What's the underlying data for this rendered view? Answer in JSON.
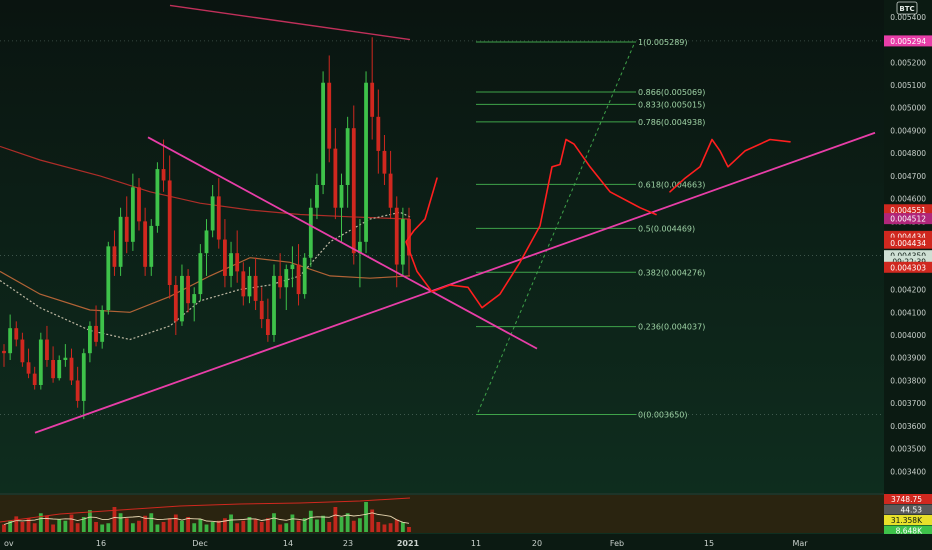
{
  "symbol_badge": "BTC",
  "colors": {
    "bg_top": "#0a1410",
    "bg_bottom": "#0f3020",
    "up": "#3ec24a",
    "down": "#d0281f",
    "fib": "#3fa34a",
    "trend": "#e83ea8",
    "drawn": "#ff1f1f",
    "ma_slow": "#c0302a",
    "ma_mid": "#c46a3a",
    "ma_fast": "#cfc6b0",
    "axis_text": "#c9d1cc"
  },
  "price_axis": {
    "ticks": [
      "0.005400",
      "0.005300",
      "0.005200",
      "0.005100",
      "0.005000",
      "0.004900",
      "0.004800",
      "0.004700",
      "0.004600",
      "0.004500",
      "0.004400",
      "0.004300",
      "0.004200",
      "0.004100",
      "0.004000",
      "0.003900",
      "0.003800",
      "0.003700",
      "0.003600",
      "0.003500",
      "0.003400"
    ],
    "badges": [
      {
        "text": "0.005294",
        "value": 0.005294,
        "bg": "#e83ea8",
        "fg": "#ffffff"
      },
      {
        "text": "0.004551",
        "value": 0.004551,
        "bg": "#d0281f",
        "fg": "#ffffff"
      },
      {
        "text": "0.004512",
        "value": 0.004512,
        "bg": "#b0267a",
        "fg": "#ffffff"
      },
      {
        "text": "0.004434",
        "value": 0.004434,
        "bg": "#d0281f",
        "fg": "#ffffff"
      },
      {
        "text": "0.004434",
        "value": 0.004404,
        "bg": "#d0281f",
        "fg": "#ffffff"
      },
      {
        "text": "0.004350",
        "value": 0.004349,
        "bg": "#cfe0d4",
        "fg": "#0b1a12"
      },
      {
        "text": "09:22:39",
        "value": 0.004324,
        "bg": "#cfe0d4",
        "fg": "#0b1a12"
      },
      {
        "text": "0.004303",
        "value": 0.004298,
        "bg": "#d0281f",
        "fg": "#ffffff"
      }
    ]
  },
  "volume_axis": {
    "badges": [
      {
        "text": "3748.75",
        "bg": "#d0281f",
        "fg": "#ffffff"
      },
      {
        "text": "44.53",
        "bg": "#5a5a5a",
        "fg": "#ffffff"
      },
      {
        "text": "31.358K",
        "bg": "#e8e02a",
        "fg": "#0b1a12"
      },
      {
        "text": "8.648K",
        "bg": "#3ec24a",
        "fg": "#ffffff"
      }
    ]
  },
  "time_axis": [
    "ov",
    "16",
    "Dec",
    "14",
    "23",
    "2021",
    "11",
    "20",
    "Feb",
    "15",
    "Mar"
  ],
  "chart_data": {
    "type": "candlestick",
    "pair": "BTC",
    "y_range": [
      0.00334,
      0.00543
    ],
    "categories": [
      "Nov",
      "16",
      "Dec",
      "14",
      "23",
      "2021",
      "11",
      "20",
      "Feb",
      "15",
      "Mar"
    ],
    "fib_levels": [
      {
        "label": "1(0.005289)",
        "value": 0.005289
      },
      {
        "label": "0.866(0.005069)",
        "value": 0.005069
      },
      {
        "label": "0.833(0.005015)",
        "value": 0.005015
      },
      {
        "label": "0.786(0.004938)",
        "value": 0.004938
      },
      {
        "label": "0.618(0.004663)",
        "value": 0.004663
      },
      {
        "label": "0.5(0.004469)",
        "value": 0.004469
      },
      {
        "label": "0.382(0.004276)",
        "value": 0.004276
      },
      {
        "label": "0.236(0.004037)",
        "value": 0.004037
      },
      {
        "label": "0(0.003650)",
        "value": 0.00365
      }
    ],
    "guide_levels": [
      0.005294,
      0.00435,
      0.00365
    ],
    "trendlines": [
      {
        "name": "support",
        "from": [
          35,
          0.00357
        ],
        "to": [
          875,
          0.00489
        ]
      },
      {
        "name": "resistance",
        "from": [
          148,
          0.00487
        ],
        "to": [
          537,
          0.00394
        ]
      },
      {
        "name": "upper",
        "from": [
          170,
          0.00545
        ],
        "to": [
          410,
          0.0053
        ]
      }
    ],
    "fib_diagonal": {
      "from": [
        478,
        0.00366
      ],
      "to": [
        634,
        0.00528
      ]
    },
    "candles": [
      {
        "o": 0.00393,
        "h": 0.00396,
        "l": 0.00386,
        "c": 0.00392
      },
      {
        "o": 0.00392,
        "h": 0.00409,
        "l": 0.00389,
        "c": 0.00403
      },
      {
        "o": 0.00403,
        "h": 0.00406,
        "l": 0.00395,
        "c": 0.00398
      },
      {
        "o": 0.00398,
        "h": 0.00401,
        "l": 0.00386,
        "c": 0.00388
      },
      {
        "o": 0.00388,
        "h": 0.00394,
        "l": 0.00381,
        "c": 0.00383
      },
      {
        "o": 0.00383,
        "h": 0.00386,
        "l": 0.00376,
        "c": 0.00378
      },
      {
        "o": 0.00378,
        "h": 0.00401,
        "l": 0.00376,
        "c": 0.00398
      },
      {
        "o": 0.00398,
        "h": 0.00404,
        "l": 0.00386,
        "c": 0.00389
      },
      {
        "o": 0.00389,
        "h": 0.00395,
        "l": 0.00379,
        "c": 0.00381
      },
      {
        "o": 0.00381,
        "h": 0.00391,
        "l": 0.0038,
        "c": 0.00389
      },
      {
        "o": 0.00389,
        "h": 0.00396,
        "l": 0.00386,
        "c": 0.0039
      },
      {
        "o": 0.0039,
        "h": 0.00394,
        "l": 0.00378,
        "c": 0.0038
      },
      {
        "o": 0.0038,
        "h": 0.00386,
        "l": 0.00368,
        "c": 0.00371
      },
      {
        "o": 0.00371,
        "h": 0.00394,
        "l": 0.00363,
        "c": 0.00392
      },
      {
        "o": 0.00392,
        "h": 0.00406,
        "l": 0.00388,
        "c": 0.00404
      },
      {
        "o": 0.00404,
        "h": 0.00413,
        "l": 0.00395,
        "c": 0.00397
      },
      {
        "o": 0.00397,
        "h": 0.00413,
        "l": 0.00394,
        "c": 0.00411
      },
      {
        "o": 0.00411,
        "h": 0.00441,
        "l": 0.00409,
        "c": 0.00439
      },
      {
        "o": 0.00439,
        "h": 0.00446,
        "l": 0.00426,
        "c": 0.0043
      },
      {
        "o": 0.0043,
        "h": 0.00456,
        "l": 0.00426,
        "c": 0.00452
      },
      {
        "o": 0.00452,
        "h": 0.00461,
        "l": 0.00436,
        "c": 0.00441
      },
      {
        "o": 0.00441,
        "h": 0.00471,
        "l": 0.00437,
        "c": 0.00465
      },
      {
        "o": 0.00465,
        "h": 0.00469,
        "l": 0.00446,
        "c": 0.0045
      },
      {
        "o": 0.0045,
        "h": 0.00456,
        "l": 0.00426,
        "c": 0.0043
      },
      {
        "o": 0.0043,
        "h": 0.00451,
        "l": 0.00426,
        "c": 0.00448
      },
      {
        "o": 0.00448,
        "h": 0.00476,
        "l": 0.00445,
        "c": 0.00473
      },
      {
        "o": 0.00473,
        "h": 0.00486,
        "l": 0.00463,
        "c": 0.00468
      },
      {
        "o": 0.00468,
        "h": 0.00479,
        "l": 0.00416,
        "c": 0.00422
      },
      {
        "o": 0.00422,
        "h": 0.00426,
        "l": 0.004,
        "c": 0.00406
      },
      {
        "o": 0.00406,
        "h": 0.00431,
        "l": 0.00404,
        "c": 0.00426
      },
      {
        "o": 0.00426,
        "h": 0.00429,
        "l": 0.0041,
        "c": 0.00414
      },
      {
        "o": 0.00414,
        "h": 0.00421,
        "l": 0.00406,
        "c": 0.00418
      },
      {
        "o": 0.00418,
        "h": 0.0044,
        "l": 0.00415,
        "c": 0.00436
      },
      {
        "o": 0.00436,
        "h": 0.00451,
        "l": 0.00426,
        "c": 0.00446
      },
      {
        "o": 0.00446,
        "h": 0.00466,
        "l": 0.00443,
        "c": 0.00461
      },
      {
        "o": 0.00461,
        "h": 0.00469,
        "l": 0.00438,
        "c": 0.00442
      },
      {
        "o": 0.00442,
        "h": 0.00451,
        "l": 0.00421,
        "c": 0.00426
      },
      {
        "o": 0.00426,
        "h": 0.00441,
        "l": 0.00421,
        "c": 0.00436
      },
      {
        "o": 0.00436,
        "h": 0.00446,
        "l": 0.00423,
        "c": 0.00428
      },
      {
        "o": 0.00428,
        "h": 0.00432,
        "l": 0.00413,
        "c": 0.00417
      },
      {
        "o": 0.00417,
        "h": 0.0043,
        "l": 0.00414,
        "c": 0.00426
      },
      {
        "o": 0.00426,
        "h": 0.00434,
        "l": 0.00411,
        "c": 0.00415
      },
      {
        "o": 0.00415,
        "h": 0.00421,
        "l": 0.00403,
        "c": 0.00407
      },
      {
        "o": 0.00407,
        "h": 0.00416,
        "l": 0.00397,
        "c": 0.004
      },
      {
        "o": 0.004,
        "h": 0.00431,
        "l": 0.00397,
        "c": 0.00426
      },
      {
        "o": 0.00426,
        "h": 0.00436,
        "l": 0.00416,
        "c": 0.00421
      },
      {
        "o": 0.00421,
        "h": 0.00431,
        "l": 0.00411,
        "c": 0.00429
      },
      {
        "o": 0.00429,
        "h": 0.00439,
        "l": 0.00421,
        "c": 0.00431
      },
      {
        "o": 0.00431,
        "h": 0.0044,
        "l": 0.00413,
        "c": 0.00418
      },
      {
        "o": 0.00418,
        "h": 0.00436,
        "l": 0.00416,
        "c": 0.00434
      },
      {
        "o": 0.00434,
        "h": 0.0046,
        "l": 0.0043,
        "c": 0.00456
      },
      {
        "o": 0.00456,
        "h": 0.00471,
        "l": 0.00451,
        "c": 0.00466
      },
      {
        "o": 0.00466,
        "h": 0.00516,
        "l": 0.00462,
        "c": 0.00511
      },
      {
        "o": 0.00511,
        "h": 0.00523,
        "l": 0.00476,
        "c": 0.00482
      },
      {
        "o": 0.00482,
        "h": 0.00491,
        "l": 0.00451,
        "c": 0.00456
      },
      {
        "o": 0.00456,
        "h": 0.00471,
        "l": 0.00441,
        "c": 0.00466
      },
      {
        "o": 0.00466,
        "h": 0.00496,
        "l": 0.00456,
        "c": 0.00491
      },
      {
        "o": 0.00491,
        "h": 0.00501,
        "l": 0.00431,
        "c": 0.00436
      },
      {
        "o": 0.00436,
        "h": 0.00451,
        "l": 0.00421,
        "c": 0.00441
      },
      {
        "o": 0.00441,
        "h": 0.00516,
        "l": 0.00436,
        "c": 0.00511
      },
      {
        "o": 0.00511,
        "h": 0.00531,
        "l": 0.00486,
        "c": 0.00496
      },
      {
        "o": 0.00496,
        "h": 0.00508,
        "l": 0.00471,
        "c": 0.00481
      },
      {
        "o": 0.00481,
        "h": 0.00488,
        "l": 0.00466,
        "c": 0.00471
      },
      {
        "o": 0.00471,
        "h": 0.00481,
        "l": 0.00451,
        "c": 0.00456
      },
      {
        "o": 0.00456,
        "h": 0.00461,
        "l": 0.00421,
        "c": 0.00431
      },
      {
        "o": 0.00431,
        "h": 0.00456,
        "l": 0.00426,
        "c": 0.00451
      },
      {
        "o": 0.00451,
        "h": 0.00456,
        "l": 0.00426,
        "c": 0.00435
      }
    ],
    "moving_averages": [
      {
        "name": "slow",
        "points": [
          [
            0,
            0.00483
          ],
          [
            40,
            0.00477
          ],
          [
            100,
            0.0047
          ],
          [
            150,
            0.00463
          ],
          [
            200,
            0.00458
          ],
          [
            250,
            0.00455
          ],
          [
            300,
            0.00453
          ],
          [
            350,
            0.00452
          ],
          [
            410,
            0.00451
          ]
        ]
      },
      {
        "name": "mid",
        "points": [
          [
            0,
            0.00428
          ],
          [
            40,
            0.00418
          ],
          [
            90,
            0.00411
          ],
          [
            130,
            0.0041
          ],
          [
            170,
            0.00417
          ],
          [
            210,
            0.00426
          ],
          [
            250,
            0.00434
          ],
          [
            290,
            0.00432
          ],
          [
            330,
            0.00426
          ],
          [
            370,
            0.00425
          ],
          [
            410,
            0.00426
          ]
        ]
      },
      {
        "name": "fast",
        "points": [
          [
            0,
            0.00424
          ],
          [
            40,
            0.00412
          ],
          [
            90,
            0.00402
          ],
          [
            130,
            0.00398
          ],
          [
            170,
            0.00404
          ],
          [
            200,
            0.00415
          ],
          [
            240,
            0.0042
          ],
          [
            270,
            0.00422
          ],
          [
            300,
            0.00426
          ],
          [
            330,
            0.00441
          ],
          [
            370,
            0.00451
          ],
          [
            400,
            0.00454
          ],
          [
            410,
            0.00452
          ]
        ]
      }
    ],
    "projection": [
      [
        437,
        0.00469
      ],
      [
        425,
        0.00451
      ],
      [
        414,
        0.00446
      ],
      [
        406,
        0.00441
      ],
      [
        417,
        0.00428
      ],
      [
        432,
        0.00419
      ],
      [
        450,
        0.00422
      ],
      [
        468,
        0.00421
      ],
      [
        482,
        0.00412
      ],
      [
        500,
        0.00418
      ],
      [
        520,
        0.00432
      ],
      [
        540,
        0.00448
      ],
      [
        552,
        0.00474
      ],
      [
        560,
        0.00475
      ],
      [
        566,
        0.00486
      ],
      [
        574,
        0.00484
      ],
      [
        590,
        0.00474
      ],
      [
        610,
        0.00463
      ],
      [
        640,
        0.00456
      ],
      [
        656,
        0.00453
      ]
    ],
    "projection2": [
      [
        670,
        0.00463
      ],
      [
        685,
        0.00469
      ],
      [
        700,
        0.00474
      ],
      [
        712,
        0.00486
      ],
      [
        720,
        0.00481
      ],
      [
        728,
        0.00474
      ],
      [
        745,
        0.00481
      ],
      [
        770,
        0.00486
      ],
      [
        790,
        0.00485
      ]
    ],
    "volume": [
      12,
      18,
      25,
      16,
      22,
      14,
      30,
      26,
      12,
      20,
      18,
      28,
      14,
      24,
      35,
      16,
      12,
      14,
      40,
      30,
      22,
      14,
      18,
      26,
      30,
      12,
      16,
      22,
      28,
      18,
      24,
      14,
      20,
      12,
      16,
      18,
      22,
      28,
      14,
      18,
      24,
      20,
      16,
      22,
      30,
      12,
      14,
      28,
      18,
      22,
      34,
      20,
      26,
      16,
      40,
      24,
      30,
      18,
      22,
      48,
      36,
      16,
      12,
      14,
      20,
      16,
      8
    ]
  }
}
